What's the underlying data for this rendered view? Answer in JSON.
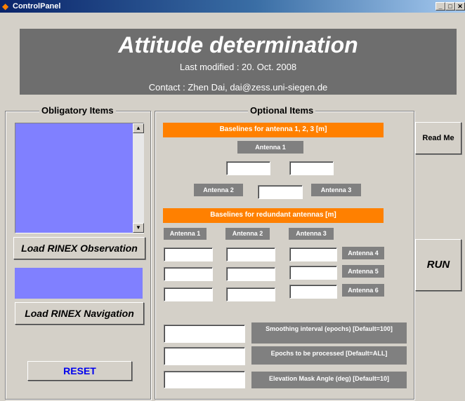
{
  "window": {
    "title": "ControlPanel",
    "min_glyph": "_",
    "max_glyph": "□",
    "close_glyph": "✕",
    "app_icon": "matlab-icon"
  },
  "header": {
    "title": "Attitude determination",
    "last_modified": "Last modified : 20. Oct. 2008",
    "contact": "Contact :  Zhen Dai, dai@zess.uni-siegen.de"
  },
  "obligatory": {
    "legend": "Obligatory Items",
    "load_obs_label": "Load RINEX Observation",
    "load_nav_label": "Load RINEX Navigation",
    "reset_label": "RESET",
    "scroll_up_glyph": "▲",
    "scroll_down_glyph": "▼"
  },
  "optional": {
    "legend": "Optional Items",
    "baselines123_label": "Baselines for antenna 1, 2, 3  [m]",
    "antenna1": "Antenna 1",
    "antenna2": "Antenna 2",
    "antenna3": "Antenna 3",
    "baselines_redundant_label": "Baselines for redundant antennas [m]",
    "col_antenna1": "Antenna 1",
    "col_antenna2": "Antenna 2",
    "col_antenna3": "Antenna 3",
    "antenna4": "Antenna 4",
    "antenna5": "Antenna 5",
    "antenna6": "Antenna 6",
    "smoothing_label": "Smoothing interval (epochs)  [Default=100]",
    "epochs_label": "Epochs to be processed  [Default=ALL]",
    "elevation_label": "Elevation Mask Angle (deg) [Default=10]"
  },
  "side": {
    "readme_label": "Read Me",
    "run_label": "RUN"
  },
  "colors": {
    "accent_orange": "#ff8000",
    "listbox_blue": "#8080ff",
    "header_gray": "#6e6e6e",
    "reset_text": "#0000ee"
  }
}
